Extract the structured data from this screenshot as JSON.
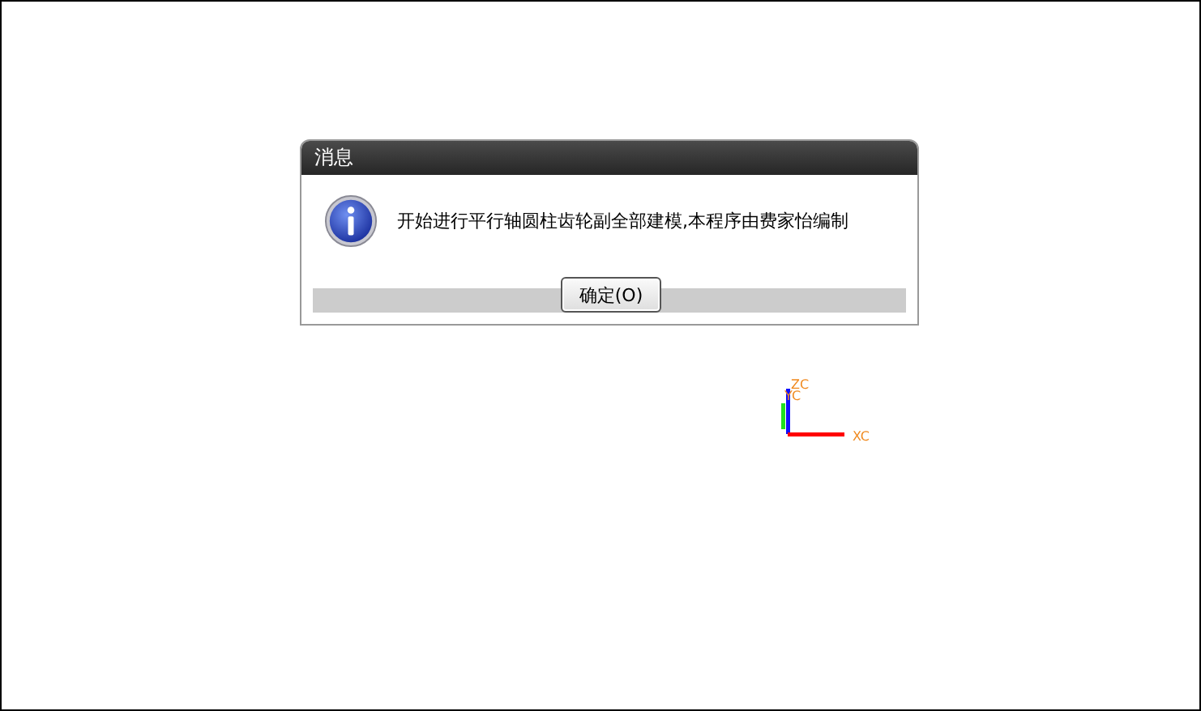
{
  "dialog": {
    "title": "消息",
    "message": "开始进行平行轴圆柱齿轮副全部建模,本程序由费家怡编制",
    "button": "确定(O)"
  },
  "axes": {
    "z_label": "ZC",
    "y_label": "YC",
    "x_label": "XC"
  }
}
